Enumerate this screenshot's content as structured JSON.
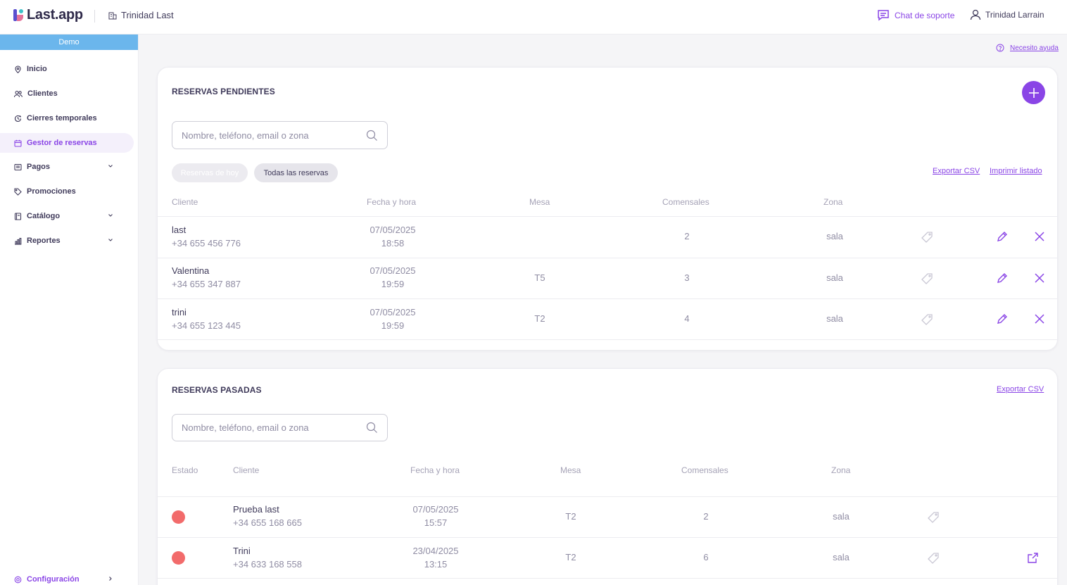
{
  "header": {
    "logo_text": "Last.app",
    "venue": "Trinidad Last",
    "support": "Chat de soporte",
    "user": "Trinidad Larrain"
  },
  "sidebar": {
    "badge": "Demo",
    "items": [
      {
        "label": "Inicio",
        "icon": "location-pin-icon"
      },
      {
        "label": "Clientes",
        "icon": "users-icon"
      },
      {
        "label": "Cierres temporales",
        "icon": "clock-icon"
      },
      {
        "label": "Gestor de reservas",
        "icon": "calendar-icon",
        "active": true
      },
      {
        "label": "Pagos",
        "icon": "receipt-icon",
        "expandable": true
      },
      {
        "label": "Promociones",
        "icon": "tag-icon"
      },
      {
        "label": "Catálogo",
        "icon": "book-icon",
        "expandable": true
      },
      {
        "label": "Reportes",
        "icon": "bar-chart-icon",
        "expandable": true
      }
    ],
    "footer_item": {
      "label": "Configuración",
      "icon": "gear-icon"
    }
  },
  "help_link": "Necesito ayuda",
  "pending": {
    "title": "RESERVAS PENDIENTES",
    "search_placeholder": "Nombre, teléfono, email o zona",
    "filters": [
      "Reservas de hoy",
      "Todas las reservas"
    ],
    "export": "Exportar CSV",
    "print": "Imprimir listado",
    "columns": [
      "Cliente",
      "Fecha y hora",
      "Mesa",
      "Comensales",
      "Zona"
    ],
    "rows": [
      {
        "name": "last",
        "phone": "+34 655 456 776",
        "date": "07/05/2025",
        "time": "18:58",
        "table": "",
        "guests": "2",
        "zone": "sala"
      },
      {
        "name": "Valentina",
        "phone": "+34 655 347 887",
        "date": "07/05/2025",
        "time": "19:59",
        "table": "T5",
        "guests": "3",
        "zone": "sala"
      },
      {
        "name": "trini",
        "phone": "+34 655 123 445",
        "date": "07/05/2025",
        "time": "19:59",
        "table": "T2",
        "guests": "4",
        "zone": "sala"
      }
    ]
  },
  "past": {
    "title": "RESERVAS PASADAS",
    "search_placeholder": "Nombre, teléfono, email o zona",
    "export": "Exportar CSV",
    "columns": [
      "Estado",
      "Cliente",
      "Fecha y hora",
      "Mesa",
      "Comensales",
      "Zona"
    ],
    "status_color": "#f26b6b",
    "rows": [
      {
        "name": "Prueba last",
        "phone": "+34 655 168 665",
        "date": "07/05/2025",
        "time": "15:57",
        "table": "T2",
        "guests": "2",
        "zone": "sala",
        "has_link": false
      },
      {
        "name": "Trini",
        "phone": "+34 633 168 558",
        "date": "23/04/2025",
        "time": "13:15",
        "table": "T2",
        "guests": "6",
        "zone": "sala",
        "has_link": true
      }
    ]
  },
  "colors": {
    "accent": "#8a45e6",
    "demo_badge": "#6bb6ec",
    "status_cancelled": "#f26b6b"
  }
}
